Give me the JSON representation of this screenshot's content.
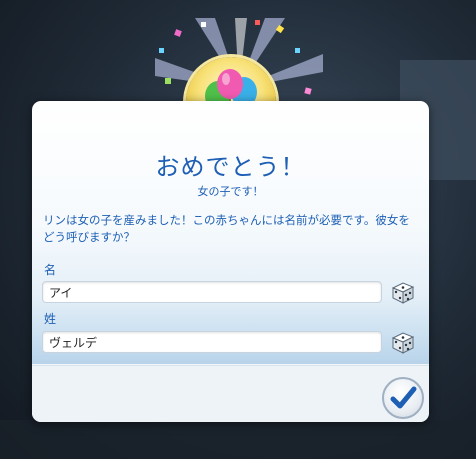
{
  "dialog": {
    "title": "おめでとう！",
    "subtitle": "女の子です！",
    "message": "リンは女の子を産みました！この赤ちゃんには名前が必要です。彼女をどう呼びますか？",
    "first_name_label": "名",
    "first_name_value": "アイ",
    "last_name_label": "姓",
    "last_name_value": "ヴェルデ"
  },
  "icons": {
    "badge": "balloons-icon",
    "dice": "dice-icon",
    "confirm": "checkmark-icon"
  },
  "colors": {
    "accent": "#1d5fb5",
    "gold": "#e9c53c"
  }
}
